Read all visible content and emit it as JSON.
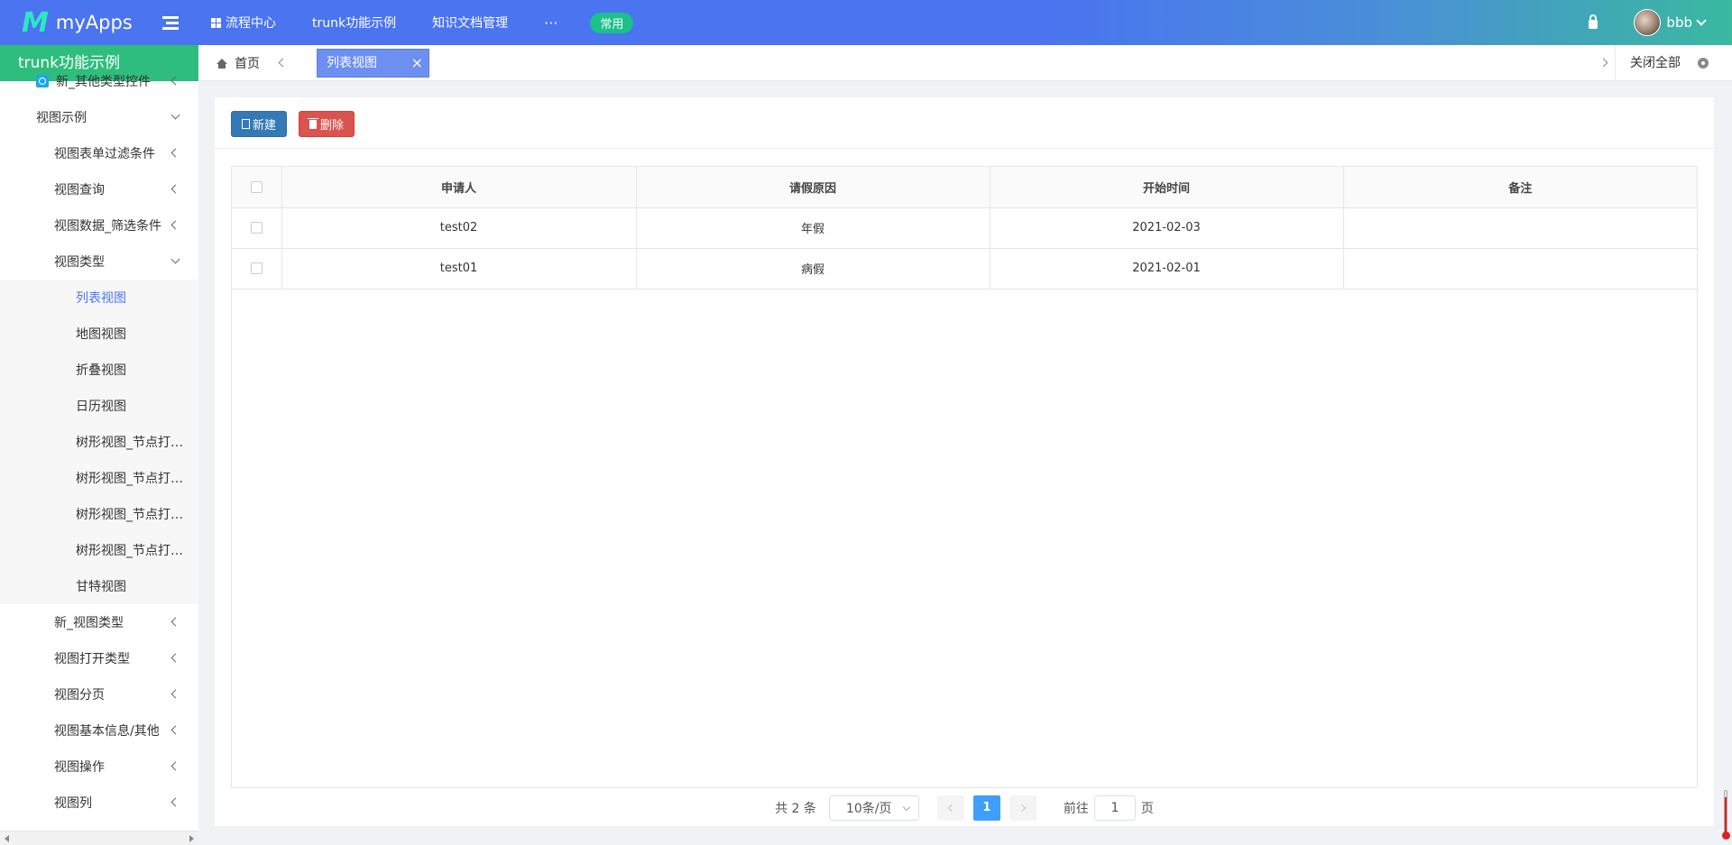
{
  "app": {
    "logo_mark": "M",
    "logo_text": "myApps"
  },
  "topnav": {
    "items": [
      "流程中心",
      "trunk功能示例",
      "知识文档管理"
    ],
    "more": "···",
    "badge": "常用"
  },
  "user": {
    "name": "bbb"
  },
  "sidebar": {
    "title": "trunk功能示例",
    "items": [
      {
        "label": "新_其他类型控件",
        "arrow": "left",
        "level": 1,
        "icon": "clock-icon"
      },
      {
        "label": "视图示例",
        "arrow": "down",
        "level": 1
      },
      {
        "label": "视图表单过滤条件",
        "arrow": "left",
        "level": 2
      },
      {
        "label": "视图查询",
        "arrow": "left",
        "level": 2
      },
      {
        "label": "视图数据_筛选条件",
        "arrow": "left",
        "level": 2
      },
      {
        "label": "视图类型",
        "arrow": "down",
        "level": 2
      },
      {
        "label": "列表视图",
        "level": 3,
        "selected": true
      },
      {
        "label": "地图视图",
        "level": 3
      },
      {
        "label": "折叠视图",
        "level": 3
      },
      {
        "label": "日历视图",
        "level": 3
      },
      {
        "label": "树形视图_节点打开...",
        "level": 3
      },
      {
        "label": "树形视图_节点打开...",
        "level": 3
      },
      {
        "label": "树形视图_节点打开...",
        "level": 3
      },
      {
        "label": "树形视图_节点打开...",
        "level": 3
      },
      {
        "label": "甘特视图",
        "level": 3
      },
      {
        "label": "新_视图类型",
        "arrow": "left",
        "level": 2
      },
      {
        "label": "视图打开类型",
        "arrow": "left",
        "level": 2
      },
      {
        "label": "视图分页",
        "arrow": "left",
        "level": 2
      },
      {
        "label": "视图基本信息/其他",
        "arrow": "left",
        "level": 2
      },
      {
        "label": "视图操作",
        "arrow": "left",
        "level": 2
      },
      {
        "label": "视图列",
        "arrow": "left",
        "level": 2
      }
    ]
  },
  "tabs": {
    "home": "首页",
    "active": "列表视图",
    "close": "×",
    "close_all": "关闭全部"
  },
  "toolbar": {
    "new_label": "新建",
    "delete_label": "删除"
  },
  "table": {
    "columns": [
      "申请人",
      "请假原因",
      "开始时间",
      "备注"
    ],
    "rows": [
      [
        "test02",
        "年假",
        "2021-02-03",
        ""
      ],
      [
        "test01",
        "病假",
        "2021-02-01",
        ""
      ]
    ]
  },
  "pagination": {
    "total": "共 2 条",
    "page_size": "10条/页",
    "current": "1",
    "goto_prefix": "前往",
    "goto_value": "1",
    "goto_suffix": "页"
  },
  "colors": {
    "topbar": "#4a74f0",
    "sidebar_title": "#2ebd7c",
    "badge": "#1cc08b",
    "active_tab": "#6d8ff2",
    "new_button": "#337ab7",
    "delete_button": "#d9534f",
    "page_active": "#409eff"
  }
}
